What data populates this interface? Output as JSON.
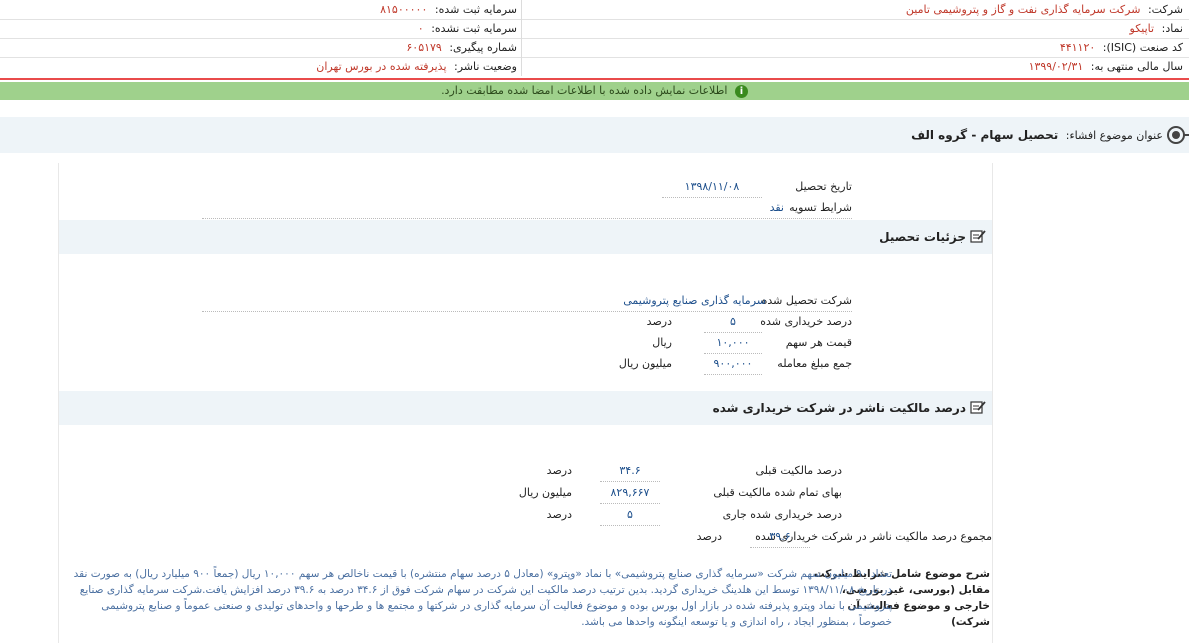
{
  "header": {
    "company_label": "شرکت:",
    "company_value": "شرکت سرمایه گذاری نفت و گاز و پتروشیمی تامین",
    "symbol_label": "نماد:",
    "symbol_value": "تاپیکو",
    "isic_label": "کد صنعت (ISIC):",
    "isic_value": "۴۴۱۱۲۰",
    "fiscal_label": "سال مالی منتهی به:",
    "fiscal_value": "۱۳۹۹/۰۲/۳۱",
    "capital_reg_label": "سرمایه ثبت شده:",
    "capital_reg_value": "۸۱۵۰۰۰۰۰",
    "capital_unreg_label": "سرمایه ثبت نشده:",
    "capital_unreg_value": "۰",
    "tracking_label": "شماره پیگیری:",
    "tracking_value": "۶۰۵۱۷۹",
    "status_label": "وضعیت ناشر:",
    "status_value": "پذیرفته شده در بورس تهران"
  },
  "banner": {
    "text": "اطلاعات نمایش داده شده با اطلاعات امضا شده مطابقت دارد.",
    "icon": "info-icon"
  },
  "subject": {
    "label": "عنوان موضوع افشاء:",
    "title": "تحصیل سهام - گروه الف"
  },
  "top_fields": {
    "date_label": "تاریخ تحصیل",
    "date_value": "۱۳۹۸/۱۱/۰۸",
    "settlement_label": "شرایط تسویه",
    "settlement_value": "نقد"
  },
  "details": {
    "title": "جزئیات تحصیل",
    "acquired_label": "شرکت تحصیل شده",
    "acquired_value": "سرمایه گذاری صنایع پتروشیمی",
    "percent_label": "درصد خریداری شده",
    "percent_value": "۵",
    "percent_unit": "درصد",
    "price_label": "قیمت هر سهم",
    "price_value": "۱۰,۰۰۰",
    "price_unit": "ریال",
    "total_label": "جمع مبلغ معامله",
    "total_value": "۹۰۰,۰۰۰",
    "total_unit": "میلیون ریال"
  },
  "ownership": {
    "title": "درصد مالکیت ناشر در شرکت خریداری شده",
    "prev_label": "درصد مالکیت قبلی",
    "prev_value": "۳۴.۶",
    "prev_unit": "درصد",
    "cost_label": "بهای تمام شده مالکیت قبلی",
    "cost_value": "۸۲۹,۶۶۷",
    "cost_unit": "میلیون ریال",
    "current_label": "درصد خریداری شده جاری",
    "current_value": "۵",
    "current_unit": "درصد",
    "sum_label": "مجموع درصد مالکیت ناشر در شرکت خریداری شده",
    "sum_value": "۳۹.۶",
    "sum_unit": "درصد"
  },
  "description": {
    "label": "شرح موضوع شامل شرایط شرکت مقابل (بورسی، غیر بورسی، خارجی و موضوع فعالیت آن شرکت)",
    "text": "تعداد ۹۰ میلیون سهم شرکت «سرمایه گذاری صنایع پتروشیمی» با نماد «وپترو» (معادل ۵ درصد سهام منتشره) با قیمت ناخالص هر سهم ۱۰,۰۰۰ ریال (جمعاً ۹۰۰ میلیارد ریال) به صورت نقد در تاریخ ۱۳۹۸/۱۱/۰۸ توسط این هلدینگ خریداری گردید. بدین ترتیب درصد مالکیت این شرکت در سهام شرکت فوق از ۳۴.۶ درصد به ۳۹.۶ درصد افزایش یافت.شرکت سرمایه گذاری صنایع پتروشیمی با نماد وپترو پذیرفته شده در بازار اول بورس بوده و موضوع فعالیت آن سرمایه گذاری در شرکتها و مجتمع ها و طرحها و واحدهای تولیدی و صنعتی عموماً و صنایع پتروشیمی خصوصاً ، بمنظور ایجاد ، راه اندازی و یا توسعه اینگونه واحدها می باشد."
  }
}
